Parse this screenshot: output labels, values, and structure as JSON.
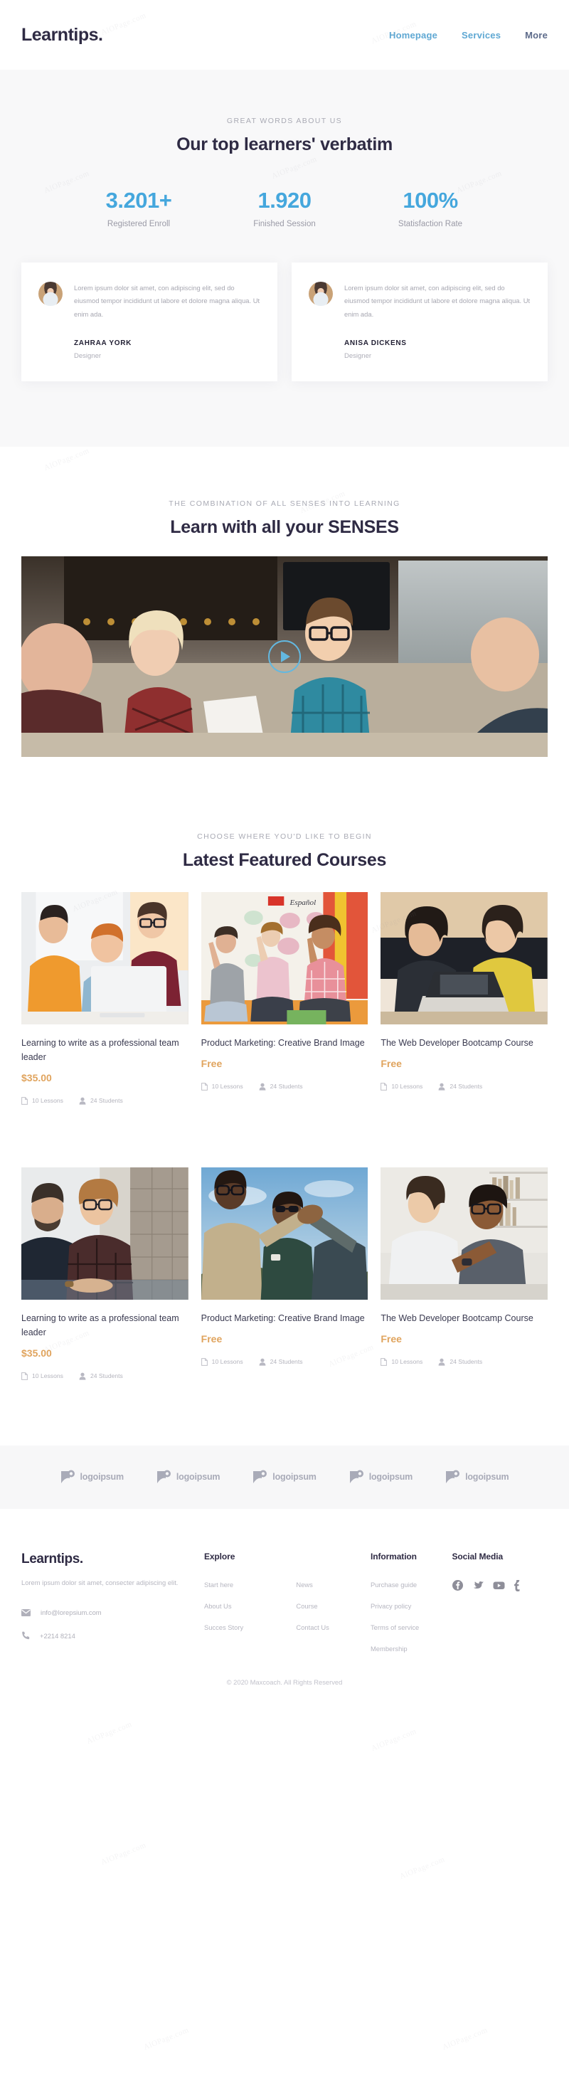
{
  "header": {
    "brand": "Learntips.",
    "nav": [
      {
        "label": "Homepage",
        "active": true
      },
      {
        "label": "Services",
        "active": true
      },
      {
        "label": "More",
        "active": false
      }
    ]
  },
  "testimonials_section": {
    "eyebrow": "GREAT WORDS ABOUT US",
    "title": "Our top learners' verbatim",
    "stats": [
      {
        "value": "3.201+",
        "label": "Registered Enroll"
      },
      {
        "value": "1.920",
        "label": "Finished Session"
      },
      {
        "value": "100%",
        "label": "Statisfaction Rate"
      }
    ],
    "cards": [
      {
        "quote": "Lorem ipsum dolor sit amet, con adipiscing elit, sed do eiusmod tempor incididunt ut labore et dolore magna aliqua. Ut enim ada.",
        "name": "ZAHRAA YORK",
        "role": "Designer"
      },
      {
        "quote": "Lorem ipsum dolor sit amet, con adipiscing elit, sed do eiusmod tempor incididunt ut labore et dolore magna aliqua. Ut enim ada.",
        "name": "ANISA DICKENS",
        "role": "Designer"
      }
    ]
  },
  "senses_section": {
    "eyebrow": "THE COMBINATION OF ALL SENSES INTO LEARNING",
    "title": "Learn with all your SENSES",
    "play_label": "Play video"
  },
  "courses_section": {
    "eyebrow": "CHOOSE WHERE YOU'D LIKE TO BEGIN",
    "title": "Latest Featured Courses",
    "cards": [
      {
        "title": "Learning to write as a professional team leader",
        "price": "$35.00",
        "lessons": "10 Lessons",
        "students": "24 Students"
      },
      {
        "title": "Product Marketing: Creative Brand Image",
        "price": "Free",
        "lessons": "10 Lessons",
        "students": "24 Students"
      },
      {
        "title": "The Web Developer Bootcamp Course",
        "price": "Free",
        "lessons": "10 Lessons",
        "students": "24 Students"
      },
      {
        "title": "Learning to write as a professional team leader",
        "price": "$35.00",
        "lessons": "10 Lessons",
        "students": "24 Students"
      },
      {
        "title": "Product Marketing: Creative Brand Image",
        "price": "Free",
        "lessons": "10 Lessons",
        "students": "24 Students"
      },
      {
        "title": "The Web Developer Bootcamp Course",
        "price": "Free",
        "lessons": "10 Lessons",
        "students": "24 Students"
      }
    ]
  },
  "logos": [
    {
      "label": "logoipsum"
    },
    {
      "label": "logoipsum"
    },
    {
      "label": "logoipsum"
    },
    {
      "label": "logoipsum"
    },
    {
      "label": "logoipsum"
    }
  ],
  "footer": {
    "brand": "Learntips.",
    "description": "Lorem ipsum dolor sit amet, consecter adipiscing elit.",
    "email": "info@lorepsium.com",
    "phone": "+2214 8214",
    "explore": {
      "heading": "Explore",
      "col1": [
        "Start here",
        "About Us",
        "Succes Story"
      ],
      "col2": [
        "News",
        "Course",
        "Contact Us"
      ]
    },
    "information": {
      "heading": "Information",
      "links": [
        "Purchase guide",
        "Privacy policy",
        "Terms of service",
        "Membership"
      ]
    },
    "social": {
      "heading": "Social Media",
      "icons": [
        "facebook-icon",
        "twitter-icon",
        "youtube-icon",
        "tumblr-icon"
      ]
    },
    "copyright": "© 2020 Maxcoach. All Rights Reserved"
  },
  "colors": {
    "accent_blue": "#45a7dd",
    "nav_blue": "#5fa8d3",
    "dark": "#2f2b44",
    "price_orange": "#e0a45e",
    "muted": "#b6b6c0",
    "bg_gray": "#f8f8f9"
  }
}
